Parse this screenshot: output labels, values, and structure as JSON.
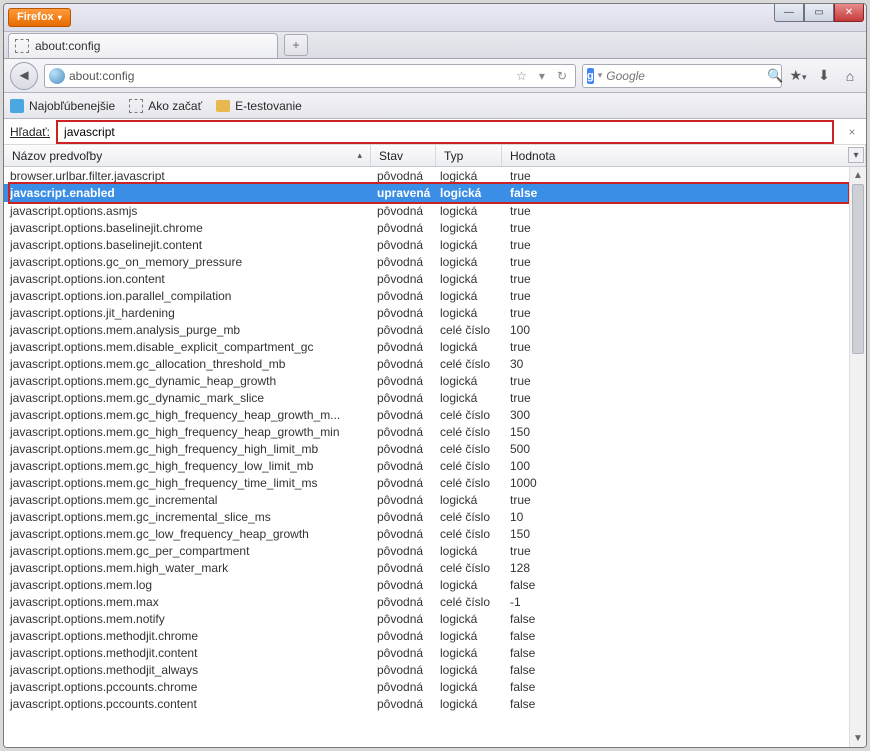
{
  "app": {
    "firefox_button": "Firefox"
  },
  "tab": {
    "title": "about:config"
  },
  "newtab": {
    "plus": "+"
  },
  "urlbar": {
    "url": "about:config",
    "star_dropdown": "▾",
    "reload": "↻"
  },
  "searchbox": {
    "engine_badge": "g",
    "engine_dropdown": "▾",
    "placeholder": "Google",
    "go": "🔍"
  },
  "toolbar_icons": {
    "bookmarks_star": "★",
    "bookmarks_dd": "▾",
    "downloads": "⬇",
    "home": "⌂"
  },
  "bookmarks": {
    "items": [
      {
        "label": "Najobľúbenejšie"
      },
      {
        "label": "Ako začať"
      },
      {
        "label": "E-testovanie"
      }
    ]
  },
  "config_search": {
    "label": "Hľadať:",
    "value": "javascript",
    "clear": "×"
  },
  "columns": {
    "name": "Názov predvoľby",
    "status": "Stav",
    "type": "Typ",
    "value": "Hodnota",
    "sort": "▴"
  },
  "selected_index": 1,
  "rows": [
    {
      "name": "browser.urlbar.filter.javascript",
      "status": "pôvodná",
      "type": "logická",
      "value": "true"
    },
    {
      "name": "javascript.enabled",
      "status": "upravená",
      "type": "logická",
      "value": "false",
      "bold": true,
      "selected": true
    },
    {
      "name": "javascript.options.asmjs",
      "status": "pôvodná",
      "type": "logická",
      "value": "true"
    },
    {
      "name": "javascript.options.baselinejit.chrome",
      "status": "pôvodná",
      "type": "logická",
      "value": "true"
    },
    {
      "name": "javascript.options.baselinejit.content",
      "status": "pôvodná",
      "type": "logická",
      "value": "true"
    },
    {
      "name": "javascript.options.gc_on_memory_pressure",
      "status": "pôvodná",
      "type": "logická",
      "value": "true"
    },
    {
      "name": "javascript.options.ion.content",
      "status": "pôvodná",
      "type": "logická",
      "value": "true"
    },
    {
      "name": "javascript.options.ion.parallel_compilation",
      "status": "pôvodná",
      "type": "logická",
      "value": "true"
    },
    {
      "name": "javascript.options.jit_hardening",
      "status": "pôvodná",
      "type": "logická",
      "value": "true"
    },
    {
      "name": "javascript.options.mem.analysis_purge_mb",
      "status": "pôvodná",
      "type": "celé číslo",
      "value": "100"
    },
    {
      "name": "javascript.options.mem.disable_explicit_compartment_gc",
      "status": "pôvodná",
      "type": "logická",
      "value": "true"
    },
    {
      "name": "javascript.options.mem.gc_allocation_threshold_mb",
      "status": "pôvodná",
      "type": "celé číslo",
      "value": "30"
    },
    {
      "name": "javascript.options.mem.gc_dynamic_heap_growth",
      "status": "pôvodná",
      "type": "logická",
      "value": "true"
    },
    {
      "name": "javascript.options.mem.gc_dynamic_mark_slice",
      "status": "pôvodná",
      "type": "logická",
      "value": "true"
    },
    {
      "name": "javascript.options.mem.gc_high_frequency_heap_growth_m...",
      "status": "pôvodná",
      "type": "celé číslo",
      "value": "300"
    },
    {
      "name": "javascript.options.mem.gc_high_frequency_heap_growth_min",
      "status": "pôvodná",
      "type": "celé číslo",
      "value": "150"
    },
    {
      "name": "javascript.options.mem.gc_high_frequency_high_limit_mb",
      "status": "pôvodná",
      "type": "celé číslo",
      "value": "500"
    },
    {
      "name": "javascript.options.mem.gc_high_frequency_low_limit_mb",
      "status": "pôvodná",
      "type": "celé číslo",
      "value": "100"
    },
    {
      "name": "javascript.options.mem.gc_high_frequency_time_limit_ms",
      "status": "pôvodná",
      "type": "celé číslo",
      "value": "1000"
    },
    {
      "name": "javascript.options.mem.gc_incremental",
      "status": "pôvodná",
      "type": "logická",
      "value": "true"
    },
    {
      "name": "javascript.options.mem.gc_incremental_slice_ms",
      "status": "pôvodná",
      "type": "celé číslo",
      "value": "10"
    },
    {
      "name": "javascript.options.mem.gc_low_frequency_heap_growth",
      "status": "pôvodná",
      "type": "celé číslo",
      "value": "150"
    },
    {
      "name": "javascript.options.mem.gc_per_compartment",
      "status": "pôvodná",
      "type": "logická",
      "value": "true"
    },
    {
      "name": "javascript.options.mem.high_water_mark",
      "status": "pôvodná",
      "type": "celé číslo",
      "value": "128"
    },
    {
      "name": "javascript.options.mem.log",
      "status": "pôvodná",
      "type": "logická",
      "value": "false"
    },
    {
      "name": "javascript.options.mem.max",
      "status": "pôvodná",
      "type": "celé číslo",
      "value": "-1"
    },
    {
      "name": "javascript.options.mem.notify",
      "status": "pôvodná",
      "type": "logická",
      "value": "false"
    },
    {
      "name": "javascript.options.methodjit.chrome",
      "status": "pôvodná",
      "type": "logická",
      "value": "false"
    },
    {
      "name": "javascript.options.methodjit.content",
      "status": "pôvodná",
      "type": "logická",
      "value": "false"
    },
    {
      "name": "javascript.options.methodjit_always",
      "status": "pôvodná",
      "type": "logická",
      "value": "false"
    },
    {
      "name": "javascript.options.pccounts.chrome",
      "status": "pôvodná",
      "type": "logická",
      "value": "false"
    },
    {
      "name": "javascript.options.pccounts.content",
      "status": "pôvodná",
      "type": "logická",
      "value": "false"
    }
  ]
}
